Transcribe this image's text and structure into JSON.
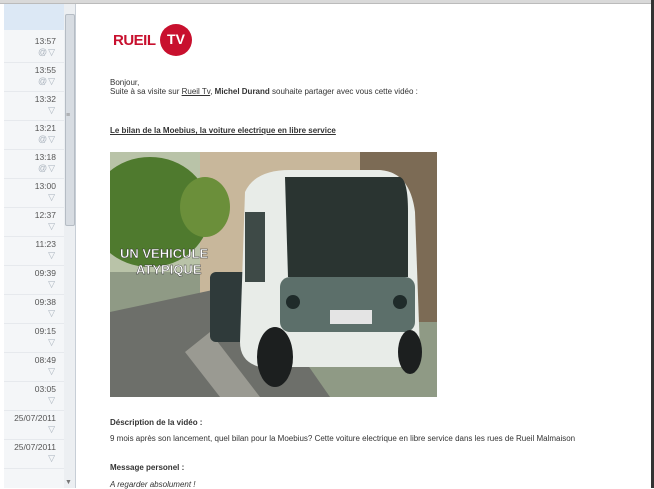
{
  "time_list": [
    {
      "time": "13:57",
      "icon": "@▽"
    },
    {
      "time": "13:55",
      "icon": "@▽"
    },
    {
      "time": "13:32",
      "icon": "▽"
    },
    {
      "time": "13:21",
      "icon": "@▽"
    },
    {
      "time": "13:18",
      "icon": "@▽"
    },
    {
      "time": "13:00",
      "icon": "▽"
    },
    {
      "time": "12:37",
      "icon": "▽"
    },
    {
      "time": "11:23",
      "icon": "▽"
    },
    {
      "time": "09:39",
      "icon": "▽"
    },
    {
      "time": "09:38",
      "icon": "▽"
    },
    {
      "time": "09:15",
      "icon": "▽"
    },
    {
      "time": "08:49",
      "icon": "▽"
    },
    {
      "time": "03:05",
      "icon": "▽"
    },
    {
      "time": "25/07/2011",
      "icon": "▽"
    },
    {
      "time": "25/07/2011",
      "icon": "▽"
    }
  ],
  "email": {
    "logo_text": "RUEIL",
    "logo_badge": "TV",
    "greeting": "Bonjour,",
    "intro_prefix": "Suite à sa visite sur ",
    "intro_link": "Rueil Tv",
    "intro_middle": ", ",
    "intro_sender": "Michel Durand",
    "intro_suffix": " souhaite partager avec vous cette vidéo :",
    "video_title": "Le bilan de la Moebius, la voiture electrique en libre service",
    "video_overlay_line1": "UN VEHICULE",
    "video_overlay_line2": "ATYPIQUE",
    "description_heading": "Déscription de la vidéo :",
    "description_text": "9 mois après son lancement, quel bilan pour la Moebius? Cette voiture electrique en libre service dans les rues de Rueil Malmaison",
    "message_heading": "Message personel :",
    "message_text": "A regarder absolument !"
  }
}
